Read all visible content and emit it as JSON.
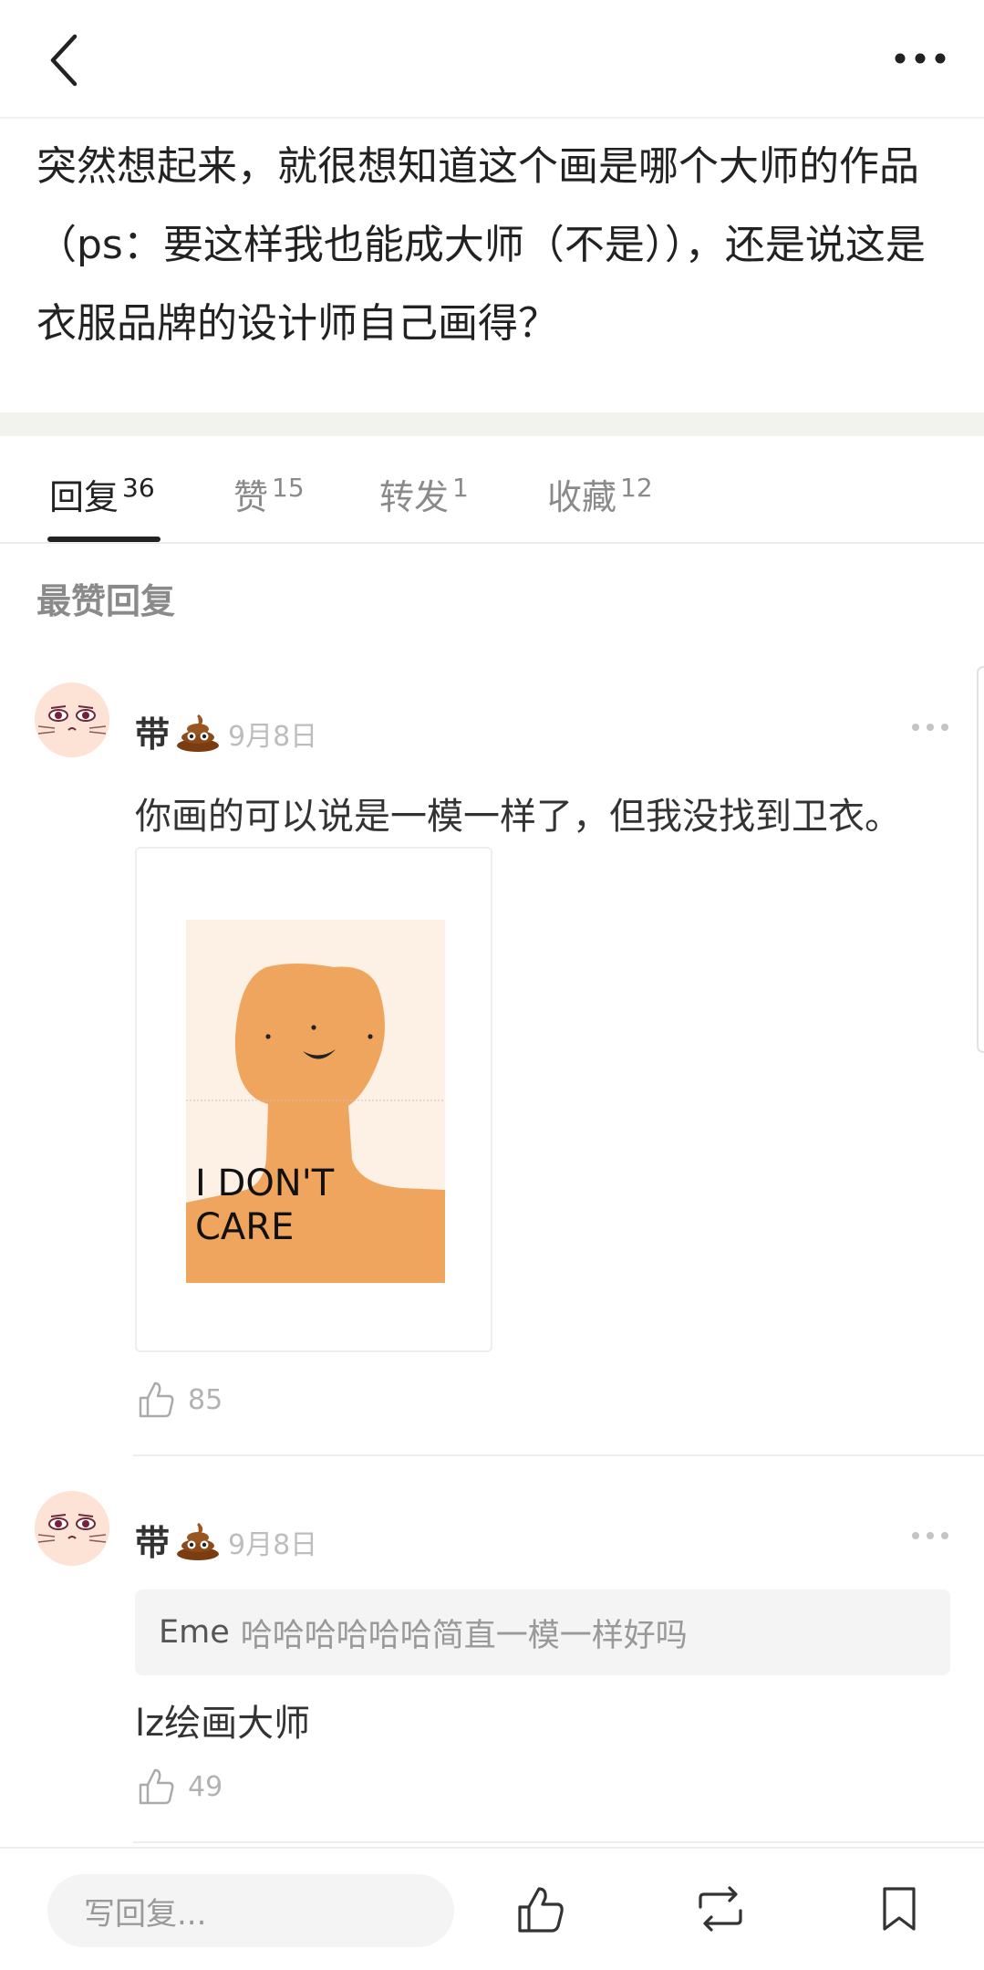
{
  "post": {
    "text": "突然想起来，就很想知道这个画是哪个大师的作品（ps：要这样我也能成大师（不是）），还是说这是衣服品牌的设计师自己画得？"
  },
  "tabs": [
    {
      "label": "回复",
      "count": "36"
    },
    {
      "label": "赞",
      "count": "15"
    },
    {
      "label": "转发",
      "count": "1"
    },
    {
      "label": "收藏",
      "count": "12"
    }
  ],
  "section_title": "最赞回复",
  "comments": [
    {
      "username": "带",
      "date": "9月8日",
      "text": "你画的可以说是一模一样了，但我没找到卫衣。",
      "image_caption": "I DON'T CARE",
      "likes": "85"
    },
    {
      "username": "带",
      "date": "9月8日",
      "quote_name": "Eme",
      "quote_text": "哈哈哈哈哈哈简直一模一样好吗",
      "text": "lz绘画大师",
      "likes": "49"
    }
  ],
  "bottom_bar": {
    "reply_placeholder": "写回复..."
  },
  "colors": {
    "muted": "#8a8a8a",
    "divider": "#eeeeee",
    "illustration_skin": "#f0a55e",
    "illustration_bg": "#fdf0e4"
  }
}
